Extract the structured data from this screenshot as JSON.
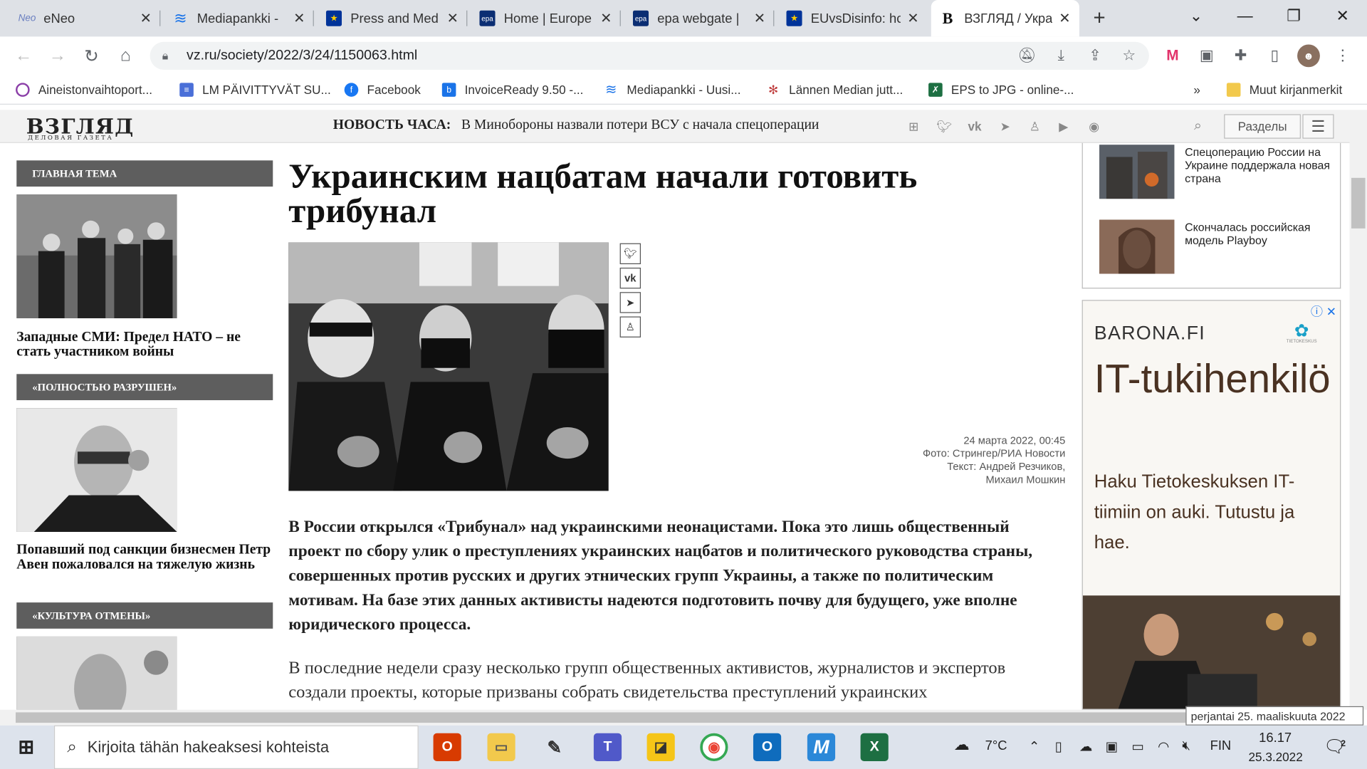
{
  "browser": {
    "tabs": [
      {
        "title": "eNeo",
        "icon": "neo-icon",
        "color": "#7b8fcf"
      },
      {
        "title": "Mediapankki -",
        "icon": "mediapankki-icon",
        "color": "#1a73e8"
      },
      {
        "title": "Press and Med",
        "icon": "eu-flag-icon",
        "color": "#003399"
      },
      {
        "title": "Home | Europe",
        "icon": "epa-icon",
        "color": "#0b2e73"
      },
      {
        "title": "epa webgate |",
        "icon": "epa-icon",
        "color": "#0b2e73"
      },
      {
        "title": "EUvsDisinfo: hc",
        "icon": "eu-flag-icon",
        "color": "#003399"
      },
      {
        "title": "ВЗГЛЯД / Укра",
        "icon": "vz-icon",
        "color": "#222222"
      }
    ],
    "new_tab": "+",
    "url": "vz.ru/society/2022/3/24/1150063.html",
    "bookmarks": [
      {
        "label": "Aineistonvaihtoport...",
        "color": "#8b3fa8"
      },
      {
        "label": "LM PÄIVITTYVÄT SU...",
        "color": "#4a6fd8"
      },
      {
        "label": "Facebook",
        "color": "#1877f2"
      },
      {
        "label": "InvoiceReady 9.50 -...",
        "color": "#1a73e8"
      },
      {
        "label": "Mediapankki - Uusi...",
        "color": "#1a73e8"
      },
      {
        "label": "Lännen Median jutt...",
        "color": "#888888"
      },
      {
        "label": "EPS to JPG - online-...",
        "color": "#1d6f42"
      }
    ],
    "bookmarks_overflow": "»",
    "other_bookmarks": "Muut kirjanmerkit"
  },
  "site": {
    "logo": "ВЗГЛЯД",
    "logo_sub": "ДЕЛОВАЯ ГАЗЕТА",
    "news_hour_label": "НОВОСТЬ ЧАСА:",
    "news_hour_text": "В Минобороны назвали потери ВСУ с начала спецоперации",
    "sections_label": "Разделы"
  },
  "left_column": [
    {
      "bar": "ГЛАВНАЯ ТЕМА",
      "caption": "Западные СМИ: Предел НАТО – не стать участником войны"
    },
    {
      "bar": "«ПОЛНОСТЬЮ РАЗРУШЕН»",
      "caption": "Попавший под санкции бизнесмен Петр Авен пожаловался на тяжелую жизнь"
    },
    {
      "bar": "«КУЛЬТУРА ОТМЕНЫ»",
      "caption": ""
    }
  ],
  "article": {
    "headline": "Украинским нацбатам начали готовить трибунал",
    "date": "24 марта 2022, 00:45",
    "photo": "Фото: Стрингер/РИА Новости",
    "text_by": "Текст: Андрей Резчиков,",
    "text_by2": "Михаил Мошкин",
    "lead": "В России открылся «Трибунал» над украинскими неонацистами. Пока это лишь общественный проект по сбору улик о преступлениях украинских нацбатов и политического руководства страны, совершенных против русских и других этнических групп Украины, а также по политическим мотивам. На базе этих данных активисты надеются подготовить почву для будущего, уже вполне юридического процесса.",
    "body": "В последние недели сразу несколько групп общественных активистов, журналистов и экспертов создали проекты, которые призваны собрать свидетельства преступлений украинских"
  },
  "right_column": {
    "news": [
      {
        "title": "Спецоперацию России на Украине поддержала новая страна"
      },
      {
        "title": "Скончалась российская модель Playboy"
      }
    ],
    "ad": {
      "brand": "BARONA.FI",
      "headline": "IT-tukihenkilö",
      "sub": "Haku Tietokeskuksen IT-tiimiin on auki. Tutustu ja hae.",
      "logo_text": "TIETOKESKUS"
    }
  },
  "tooltip": "perjantai 25. maaliskuuta 2022",
  "taskbar": {
    "search_placeholder": "Kirjoita tähän hakeaksesi kohteista",
    "weather": "7°C",
    "lang": "FIN",
    "time": "16.17",
    "date": "25.3.2022",
    "notifications": "2"
  }
}
